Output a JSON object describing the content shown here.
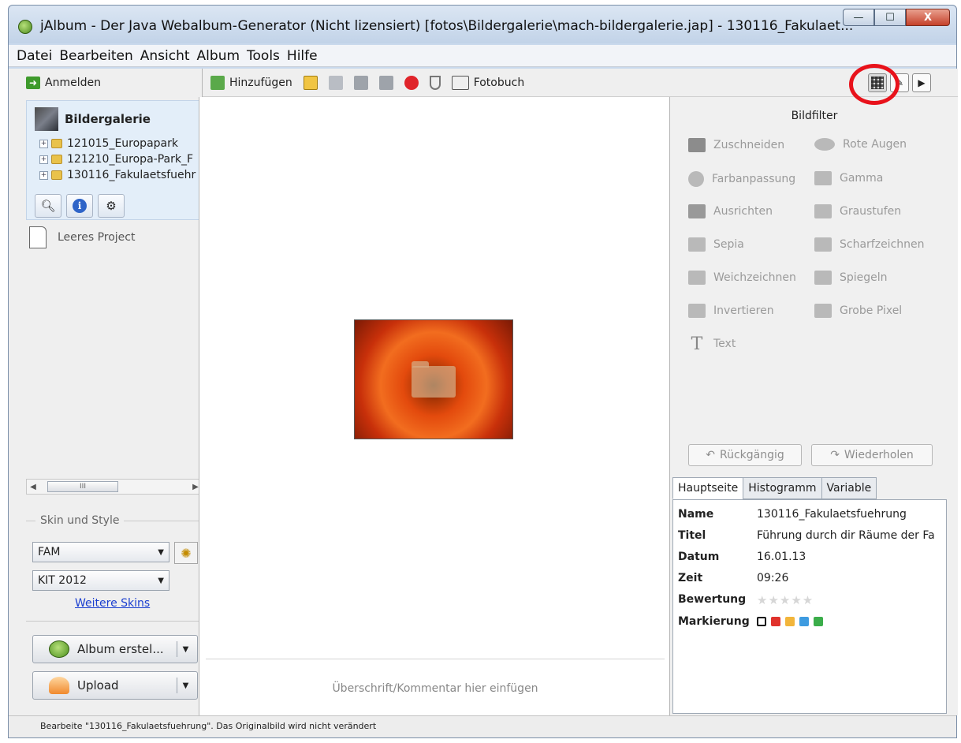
{
  "window": {
    "title": "jAlbum - Der Java Webalbum-Generator (Nicht lizensiert) [fotos\\Bildergalerie\\mach-bildergalerie.jap] - 130116_Fakulaet...",
    "min": "—",
    "max": "☐",
    "close": "X"
  },
  "menu": [
    "Datei",
    "Bearbeiten",
    "Ansicht",
    "Album",
    "Tools",
    "Hilfe"
  ],
  "left": {
    "login": "Anmelden",
    "root": "Bildergalerie",
    "tree": [
      "121015_Europapark",
      "121210_Europa-Park_F",
      "130116_Fakulaetsfuehr"
    ],
    "empty_project": "Leeres Project",
    "scroll_thumb": "III",
    "skin_section": "Skin und Style",
    "skin_value": "FAM",
    "style_value": "KIT 2012",
    "more_skins": "Weitere Skins",
    "make_album": "Album erstel...",
    "upload": "Upload"
  },
  "toolbar": {
    "add": "Hinzufügen",
    "photobook": "Fotobuch"
  },
  "center": {
    "caption_placeholder": "Überschrift/Kommentar hier einfügen"
  },
  "filters": {
    "title": "Bildfilter",
    "left": [
      "Zuschneiden",
      "Farbanpassung",
      "Ausrichten",
      "Sepia",
      "Weichzeichnen",
      "Invertieren",
      "Text"
    ],
    "right": [
      "Rote Augen",
      "Gamma",
      "Graustufen",
      "Scharfzeichnen",
      "Spiegeln",
      "Grobe Pixel"
    ],
    "undo": "Rückgängig",
    "redo": "Wiederholen"
  },
  "tabs": [
    "Hauptseite",
    "Histogramm",
    "Variable"
  ],
  "props": {
    "name_key": "Name",
    "name_val": "130116_Fakulaetsfuehrung",
    "title_key": "Titel",
    "title_val": "Führung durch dir Räume der Fa",
    "date_key": "Datum",
    "date_val": "16.01.13",
    "time_key": "Zeit",
    "time_val": "09:26",
    "rating_key": "Bewertung",
    "rating_stars": "★★★★★",
    "mark_key": "Markierung",
    "mark_colors": [
      "#ffffff",
      "#e0322c",
      "#f2b53b",
      "#3e9be0",
      "#3bad4a"
    ]
  },
  "status": "Bearbeite \"130116_Fakulaetsfuehrung\". Das Originalbild wird nicht verändert"
}
